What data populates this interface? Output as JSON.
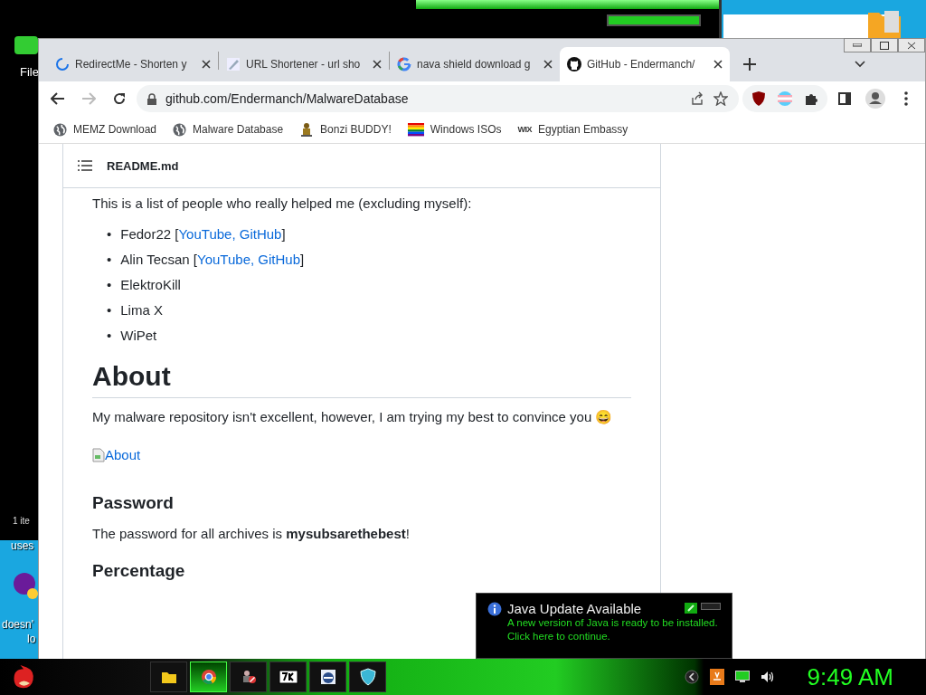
{
  "background": {
    "menu_label": "File",
    "status_label": "1 ite",
    "desktop_labels": [
      "uses",
      "doesn'",
      "lo"
    ]
  },
  "browser": {
    "tabs": [
      {
        "title": "RedirectMe - Shorten y",
        "kind": "loading",
        "selected": false
      },
      {
        "title": "URL Shortener - url sho",
        "kind": "image",
        "selected": false
      },
      {
        "title": "nava shield download g",
        "kind": "google",
        "selected": false
      },
      {
        "title": "GitHub - Endermanch/",
        "kind": "github",
        "selected": true
      }
    ],
    "address": "github.com/Endermanch/MalwareDatabase",
    "bookmarks": [
      {
        "label": "MEMZ Download",
        "kind": "globe"
      },
      {
        "label": "Malware Database",
        "kind": "globe"
      },
      {
        "label": "Bonzi BUDDY!",
        "kind": "figure"
      },
      {
        "label": "Windows ISOs",
        "kind": "rainbow"
      },
      {
        "label": "Egyptian Embassy",
        "kind": "logo",
        "logo": "WIX"
      }
    ]
  },
  "readme": {
    "title": "README.md",
    "intro": "This is a list of people who really helped me (excluding myself):",
    "people": [
      {
        "marker": "•",
        "name": "Fedor22 [",
        "links": "YouTube, GitHub",
        "after": "]"
      },
      {
        "marker": "•",
        "name": "Alin Tecsan [",
        "links": "YouTube, GitHub",
        "after": "]"
      },
      {
        "marker": "•",
        "name": "ElektroKill"
      },
      {
        "marker": "•",
        "name": "Lima X"
      },
      {
        "marker": "•",
        "name": "WiPet"
      }
    ],
    "about_heading": "About",
    "about_text": "My malware repository isn't excellent, however, I am trying my best to convince you 😄",
    "image_alt": "About",
    "password_heading": "Password",
    "password_text": "The password for all archives is **mysubsarethebest**!",
    "percentage_heading": "Percentage"
  },
  "notification": {
    "title": "Java Update Available",
    "message": "A new version of Java is ready to be installed.",
    "action": "Click here to continue."
  },
  "taskbar": {
    "apps": [
      {
        "kind": "folder",
        "selected": false
      },
      {
        "kind": "chrome",
        "selected": true
      },
      {
        "kind": "figure",
        "selected": false
      },
      {
        "kind": "archiver",
        "selected": false
      },
      {
        "kind": "disc",
        "selected": false
      },
      {
        "kind": "shield",
        "selected": false
      }
    ],
    "clock": "9:49 AM"
  }
}
